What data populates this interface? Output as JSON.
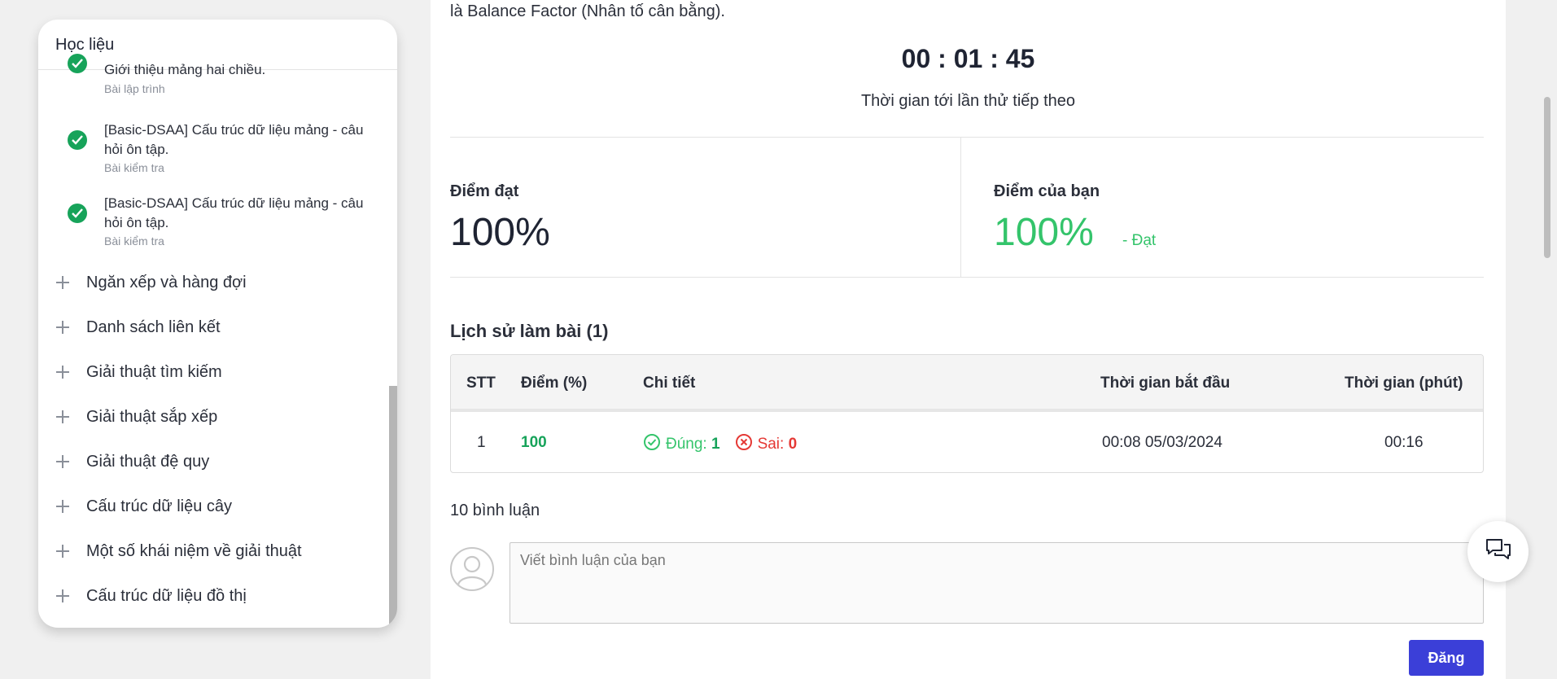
{
  "sidebar": {
    "title": "Học liệu",
    "lessons": [
      {
        "title": "Giới thiệu mảng hai chiều.",
        "type": "Bài lập trình",
        "completed": true
      },
      {
        "title": "[Basic-DSAA] Cấu trúc dữ liệu mảng - câu hỏi ôn tập.",
        "type": "Bài kiểm tra",
        "completed": true
      },
      {
        "title": "[Basic-DSAA] Cấu trúc dữ liệu mảng - câu hỏi ôn tập.",
        "type": "Bài kiểm tra",
        "completed": true
      }
    ],
    "sections": [
      {
        "label": "Ngăn xếp và hàng đợi"
      },
      {
        "label": "Danh sách liên kết"
      },
      {
        "label": "Giải thuật tìm kiếm"
      },
      {
        "label": "Giải thuật sắp xếp"
      },
      {
        "label": "Giải thuật đệ quy"
      },
      {
        "label": "Cấu trúc dữ liệu cây"
      },
      {
        "label": "Một số khái niệm về giải thuật"
      },
      {
        "label": "Cấu trúc dữ liệu đồ thị"
      }
    ]
  },
  "main": {
    "intro_text": "là Balance Factor (Nhân tố cân bằng).",
    "timer": {
      "value": "00 : 01 : 45",
      "label": "Thời gian tới lần thử tiếp theo"
    },
    "scores": {
      "pass_label": "Điểm đạt",
      "pass_value": "100%",
      "your_label": "Điểm của bạn",
      "your_value": "100%",
      "your_status": "- Đạt"
    },
    "history": {
      "title": "Lịch sử làm bài (1)",
      "columns": [
        "STT",
        "Điểm (%)",
        "Chi tiết",
        "Thời gian bắt đầu",
        "Thời gian (phút)"
      ],
      "rows": [
        {
          "index": "1",
          "score": "100",
          "correct_label": "Đúng:",
          "correct_value": "1",
          "wrong_label": "Sai:",
          "wrong_value": "0",
          "start_time": "00:08 05/03/2024",
          "duration": "00:16"
        }
      ]
    },
    "comments": {
      "count_label": "10 bình luận",
      "placeholder": "Viết bình luận của bạn",
      "submit_label": "Đăng"
    }
  },
  "colors": {
    "success": "#34c46b",
    "success_dark": "#17a35a",
    "error": "#e53935",
    "primary": "#3b3fd8"
  },
  "icons": {
    "lesson_status": "check-circle-icon",
    "section_toggle": "plus-icon",
    "correct": "check-circle-outline-icon",
    "wrong": "x-circle-outline-icon",
    "avatar": "user-avatar-icon",
    "chat": "chat-bubbles-icon"
  }
}
